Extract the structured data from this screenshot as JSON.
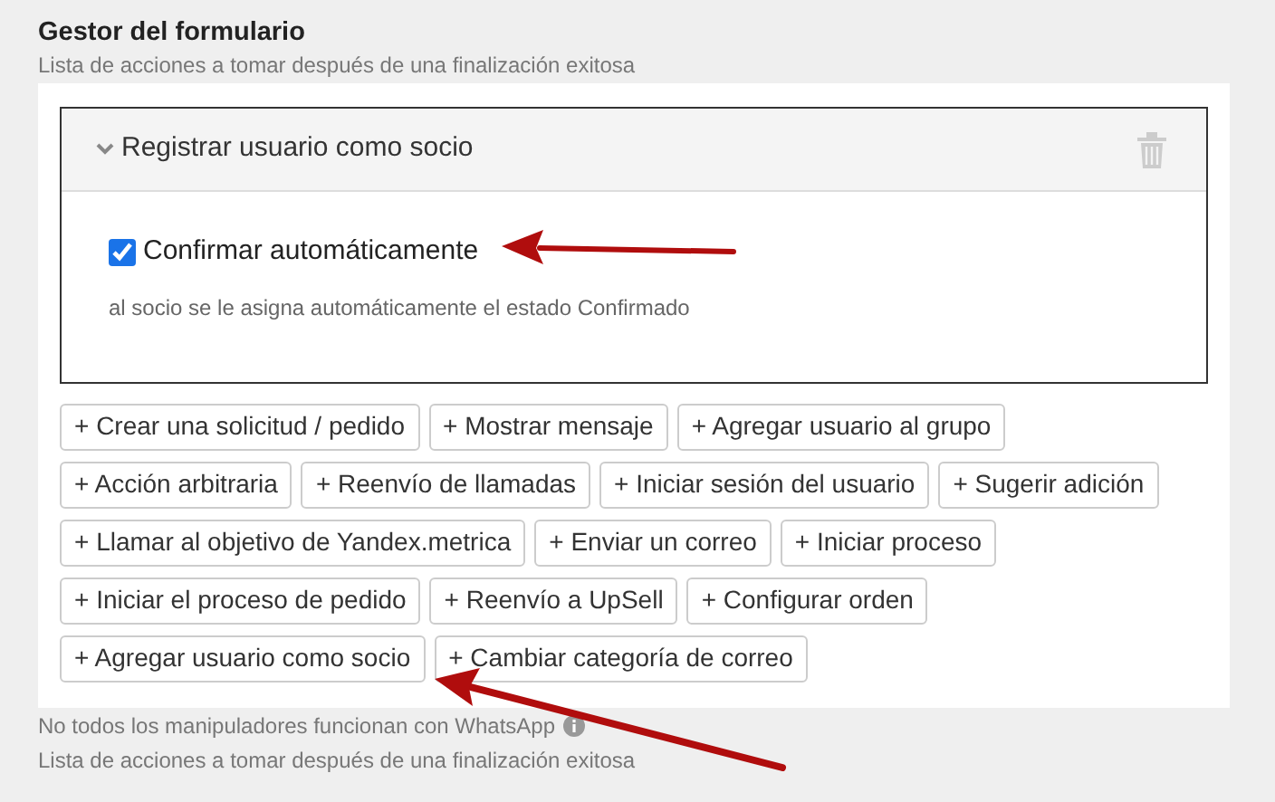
{
  "title": "Gestor del formulario",
  "subtitle": "Lista de acciones a tomar después de una finalización exitosa",
  "action": {
    "title": "Registrar usuario como socio",
    "expanded": true,
    "checkbox": {
      "label": "Confirmar automáticamente",
      "checked": true
    },
    "help": "al socio se le asigna automáticamente el estado Confirmado"
  },
  "button_rows": [
    [
      "+ Crear una solicitud / pedido",
      "+ Mostrar mensaje",
      "+ Agregar usuario al grupo"
    ],
    [
      "+ Acción arbitraria",
      "+ Reenvío de llamadas",
      "+ Iniciar sesión del usuario",
      "+ Sugerir adición"
    ],
    [
      "+ Llamar al objetivo de Yandex.metrica",
      "+ Enviar un correo",
      "+ Iniciar proceso"
    ],
    [
      "+ Iniciar el proceso de pedido",
      "+ Reenvío a UpSell",
      "+ Configurar orden"
    ],
    [
      "+ Agregar usuario como socio",
      "+ Cambiar categoría de correo"
    ]
  ],
  "note": "No todos los manipuladores funcionan con WhatsApp",
  "footer": "Lista de acciones a tomar después de una finalización exitosa"
}
